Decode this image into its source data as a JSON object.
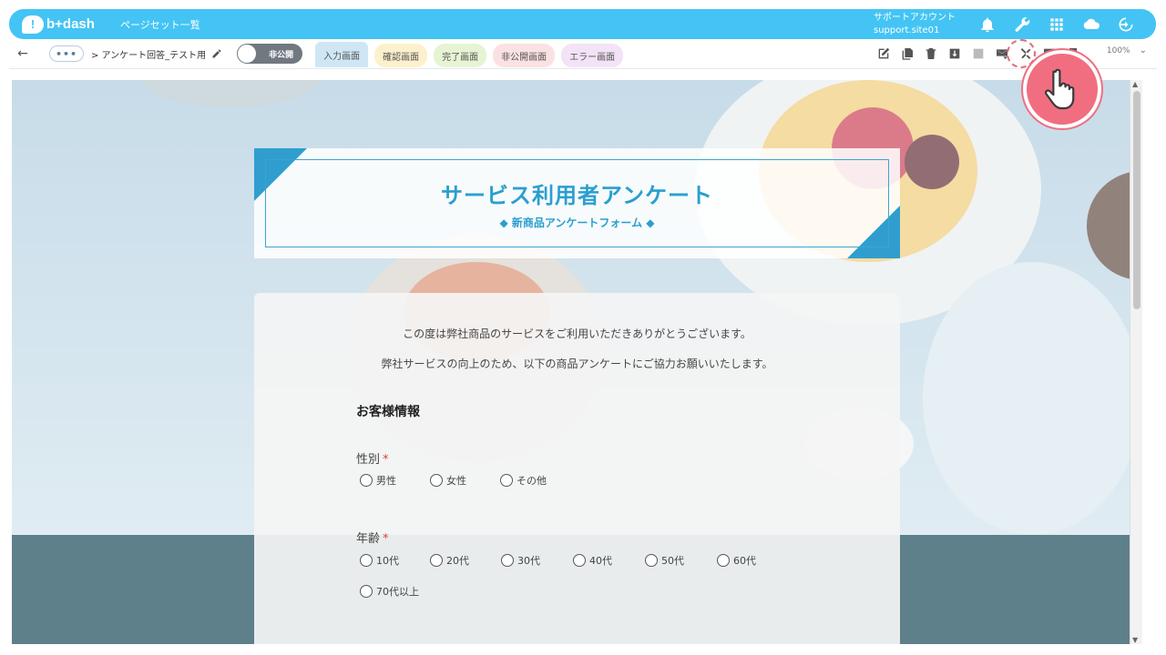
{
  "app": {
    "brand": "b+dash",
    "brand_mark": "!",
    "nav_title": "ページセット一覧"
  },
  "account": {
    "label": "サポートアカウント",
    "id": "support.site01"
  },
  "header_icons": [
    "bell-icon",
    "wrench-icon",
    "grid-icon",
    "cloud-icon",
    "logout-icon"
  ],
  "toolbar": {
    "back": "←",
    "more": "•••",
    "breadcrumb": "> アンケート回答_テスト用",
    "toggle_label": "非公開",
    "tabs": [
      {
        "label": "入力画面",
        "active": true
      },
      {
        "label": "確認画面"
      },
      {
        "label": "完了画面"
      },
      {
        "label": "非公開画面"
      },
      {
        "label": "エラー画面"
      }
    ],
    "icons": [
      "edit-icon",
      "copy-icon",
      "delete-icon",
      "download-icon",
      "upload-icon",
      "mail-icon",
      "tools-icon",
      "preview-icon",
      "publish-icon"
    ],
    "zoom": "100%"
  },
  "form": {
    "title": "サービス利用者アンケート",
    "subtitle": "◆ 新商品アンケートフォーム ◆",
    "intro_1": "この度は弊社商品のサービスをご利用いただきありがとうございます。",
    "intro_2": "弊社サービスの向上のため、以下の商品アンケートにご協力お願いいたします。",
    "section": "お客様情報",
    "required_mark": "*",
    "gender": {
      "label": "性別",
      "options": [
        "男性",
        "女性",
        "その他"
      ]
    },
    "age": {
      "label": "年齢",
      "options": [
        "10代",
        "20代",
        "30代",
        "40代",
        "50代",
        "60代",
        "70代以上"
      ]
    }
  }
}
